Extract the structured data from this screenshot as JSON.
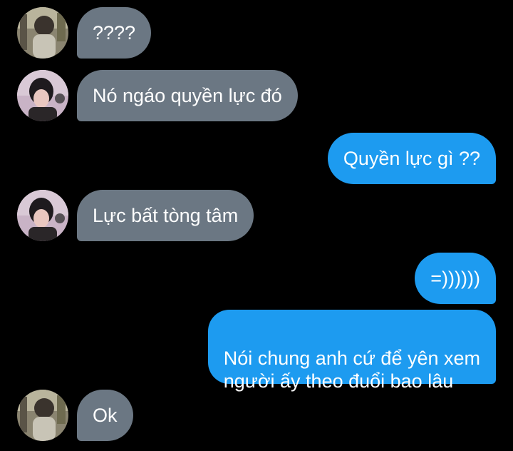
{
  "conversation": {
    "messages": [
      {
        "sender": "other_a",
        "text": "????"
      },
      {
        "sender": "other_b",
        "text": "Nó ngáo quyền lực đó"
      },
      {
        "sender": "me",
        "text": "Quyền lực gì ??"
      },
      {
        "sender": "other_b",
        "text": "Lực bất tòng tâm"
      },
      {
        "sender": "me",
        "text": "=))))))"
      },
      {
        "sender": "me",
        "text": "Nói chung anh cứ để yên xem\nngười ấy theo đuổi bao lâu"
      },
      {
        "sender": "other_a",
        "text": "Ok"
      }
    ]
  },
  "colors": {
    "background": "#000000",
    "incoming_bubble": "#6b7783",
    "outgoing_bubble": "#1d9bf0",
    "text": "#ffffff"
  },
  "icons": {
    "avatar_a": "avatar-photo-icon",
    "avatar_b": "avatar-photo-icon"
  }
}
